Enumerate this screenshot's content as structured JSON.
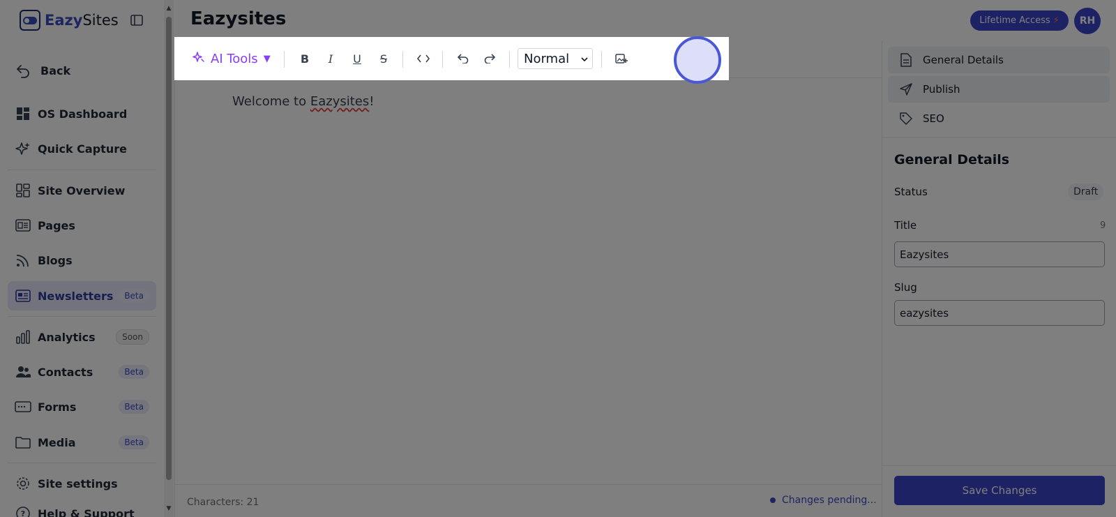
{
  "app": {
    "logo_bold": "Eazy",
    "logo_rest": "Sites"
  },
  "sidebar": {
    "back": "Back",
    "items": [
      {
        "label": "OS Dashboard"
      },
      {
        "label": "Quick Capture"
      },
      {
        "label": "Site Overview"
      },
      {
        "label": "Pages"
      },
      {
        "label": "Blogs"
      },
      {
        "label": "Newsletters",
        "badge": "Beta"
      },
      {
        "label": "Analytics",
        "badge": "Soon"
      },
      {
        "label": "Contacts",
        "badge": "Beta"
      },
      {
        "label": "Forms",
        "badge": "Beta"
      },
      {
        "label": "Media",
        "badge": "Beta"
      },
      {
        "label": "Site settings"
      },
      {
        "label": "Help & Support"
      }
    ],
    "active_item": "Newsletters"
  },
  "header": {
    "title": "Eazysites",
    "lifetime_label": "Lifetime Access",
    "lifetime_icon": "bolt-icon",
    "avatar_initials": "RH"
  },
  "toolbar": {
    "ai_tools": "AI Tools",
    "caret": "▼",
    "text_style": "Normal"
  },
  "editor": {
    "text_before": "Welcome to ",
    "text_spell": "Eazysites",
    "text_after": "!",
    "characters": "Characters: 21",
    "status": "Changes pending..."
  },
  "right_panel": {
    "tabs": [
      {
        "label": "General Details"
      },
      {
        "label": "Publish"
      },
      {
        "label": "SEO"
      }
    ],
    "heading": "General Details",
    "status_label": "Status",
    "status_value": "Draft",
    "title_label": "Title",
    "title_count": "9",
    "title_value": "Eazysites",
    "slug_label": "Slug",
    "slug_value": "eazysites",
    "save_label": "Save Changes"
  },
  "colors": {
    "accent": "#3b44c8",
    "ai_purple": "#8b3cf7",
    "active_nav_bg": "#e4e7fb"
  }
}
